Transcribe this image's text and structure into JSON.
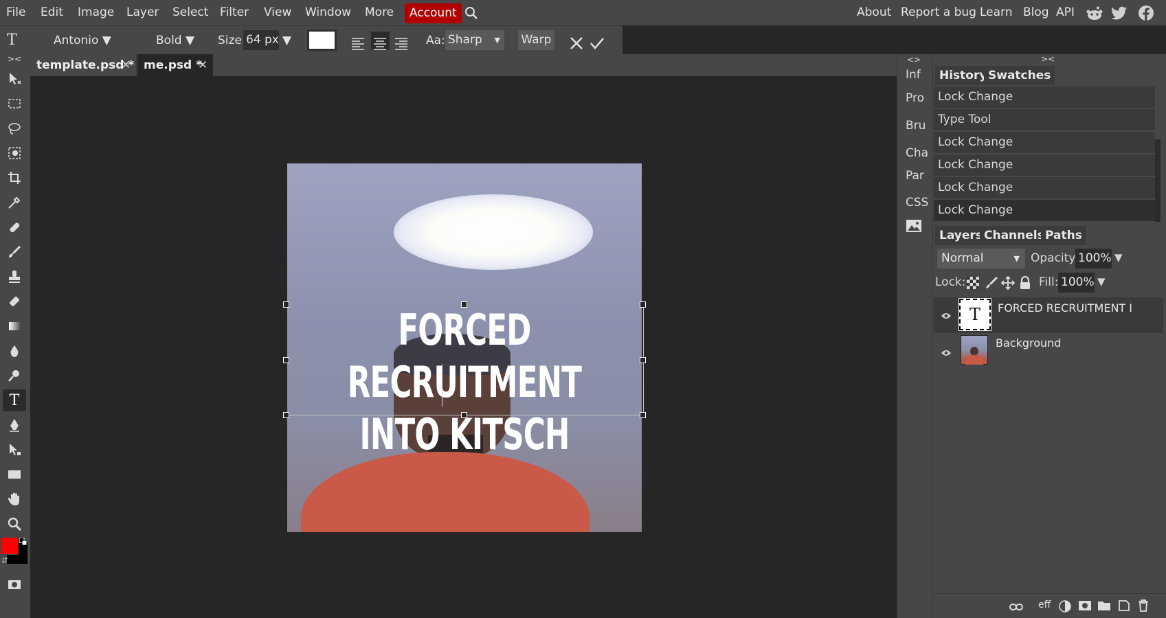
{
  "menu": {
    "items": [
      "File",
      "Edit",
      "Image",
      "Layer",
      "Select",
      "Filter",
      "View",
      "Window",
      "More"
    ],
    "account": "Account",
    "right_links": [
      "About",
      "Report a bug",
      "Learn",
      "Blog",
      "API"
    ]
  },
  "options": {
    "font": "Antonio",
    "weight": "Bold",
    "size_label": "Size:",
    "size_value": "64 px",
    "aa_label": "Aa:",
    "aa_value": "Sharp",
    "warp": "Warp",
    "color": "#ffffff"
  },
  "tabs": [
    {
      "label": "template.psd *"
    },
    {
      "label": "me.psd *"
    }
  ],
  "mini_panels": [
    "Inf",
    "Pro",
    "Bru",
    "Cha",
    "Par",
    "CSS"
  ],
  "history": {
    "tab_history": "History",
    "tab_swatches": "Swatches",
    "entries": [
      "Lock Change",
      "Type Tool",
      "Lock Change",
      "Lock Change",
      "Lock Change",
      "Lock Change"
    ]
  },
  "layers": {
    "tab_layers": "Layers",
    "tab_channels": "Channels",
    "tab_paths": "Paths",
    "blend_mode": "Normal",
    "opacity_label": "Opacity:",
    "opacity_value": "100%",
    "lock_label": "Lock:",
    "fill_label": "Fill:",
    "fill_value": "100%",
    "items": [
      {
        "name": "FORCED RECRUITMENT I",
        "thumb": "T"
      },
      {
        "name": "Background"
      }
    ]
  },
  "canvas_text": {
    "line1": "FORCED RECRUITMENT",
    "line2": "INTO KITSCH"
  },
  "colors": {
    "foreground": "#ff0000",
    "background": "#000000",
    "accent": "#b20000"
  }
}
